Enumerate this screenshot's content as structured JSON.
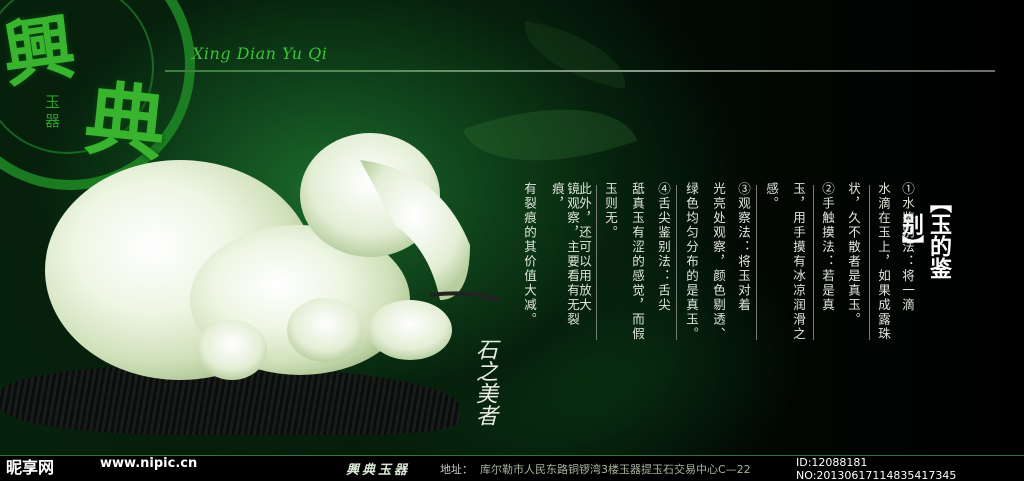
{
  "logo": {
    "char_1": "興",
    "char_2": "典",
    "sub": "玉器"
  },
  "pinyin": "Xing Dian Yu Qi",
  "title": "【玉的鉴别】",
  "columns": [
    "①水鉴别法：将一滴",
    "水滴在玉上，如果成露珠",
    "状，久不散者是真玉。",
    "②手触摸法：若是真",
    "玉，用手摸有冰凉润滑之",
    "感。",
    "③观察法：将玉对着",
    "光亮处观察，颜色剔透、",
    "绿色均匀分布的是真玉。",
    "④舌尖鉴别法：舌尖",
    "舐真玉有涩的感觉，而假",
    "玉则无。",
    "此外，还可以用放大",
    "镜观察，主要看有无裂痕，",
    "有裂痕的其价值大减。"
  ],
  "calligraphy": "石之美者",
  "footer": {
    "watermark": "昵享网",
    "watermark_url": "www.nipic.cn",
    "brand": "興典玉器",
    "address_label": "地址：",
    "address": "库尔勒市人民东路铜锣湾3楼玉器提玉石交易中心C—22",
    "image_id": "ID:12088181 NO:20130617114835417345"
  },
  "colors": {
    "accent_green": "#38b42e",
    "text": "#dfe6dc",
    "background": "#000000"
  }
}
